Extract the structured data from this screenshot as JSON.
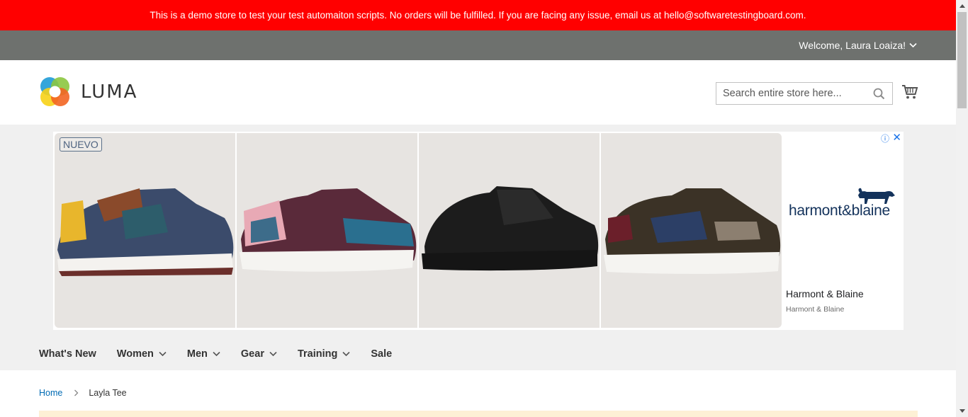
{
  "demo_banner": {
    "text": "This is a demo store to test your test automaiton scripts. No orders will be fulfilled. If you are facing any issue, email us at hello@softwaretestingboard.com."
  },
  "top_bar": {
    "welcome": "Welcome, Laura Loaiza!"
  },
  "header": {
    "logo_text": "LUMA",
    "search_placeholder": "Search entire store here...",
    "icons": [
      "search-icon",
      "cart-icon"
    ]
  },
  "ad": {
    "badge": "NUEVO",
    "brand_logo_text": "harmont&blaine",
    "title": "Harmont & Blaine",
    "subtitle": "Harmont & Blaine",
    "close_glyph": "✕",
    "info_glyph": "ⓘ"
  },
  "nav": {
    "items": [
      {
        "label": "What's New",
        "has_dropdown": false
      },
      {
        "label": "Women",
        "has_dropdown": true
      },
      {
        "label": "Men",
        "has_dropdown": true
      },
      {
        "label": "Gear",
        "has_dropdown": true
      },
      {
        "label": "Training",
        "has_dropdown": true
      },
      {
        "label": "Sale",
        "has_dropdown": false
      }
    ]
  },
  "breadcrumb": {
    "home": "Home",
    "current": "Layla Tee"
  },
  "colors": {
    "demo_banner_bg": "#ff0000",
    "top_bar_bg": "#6e716e",
    "link": "#006bb4",
    "nav_bg": "#f0f0f0"
  }
}
